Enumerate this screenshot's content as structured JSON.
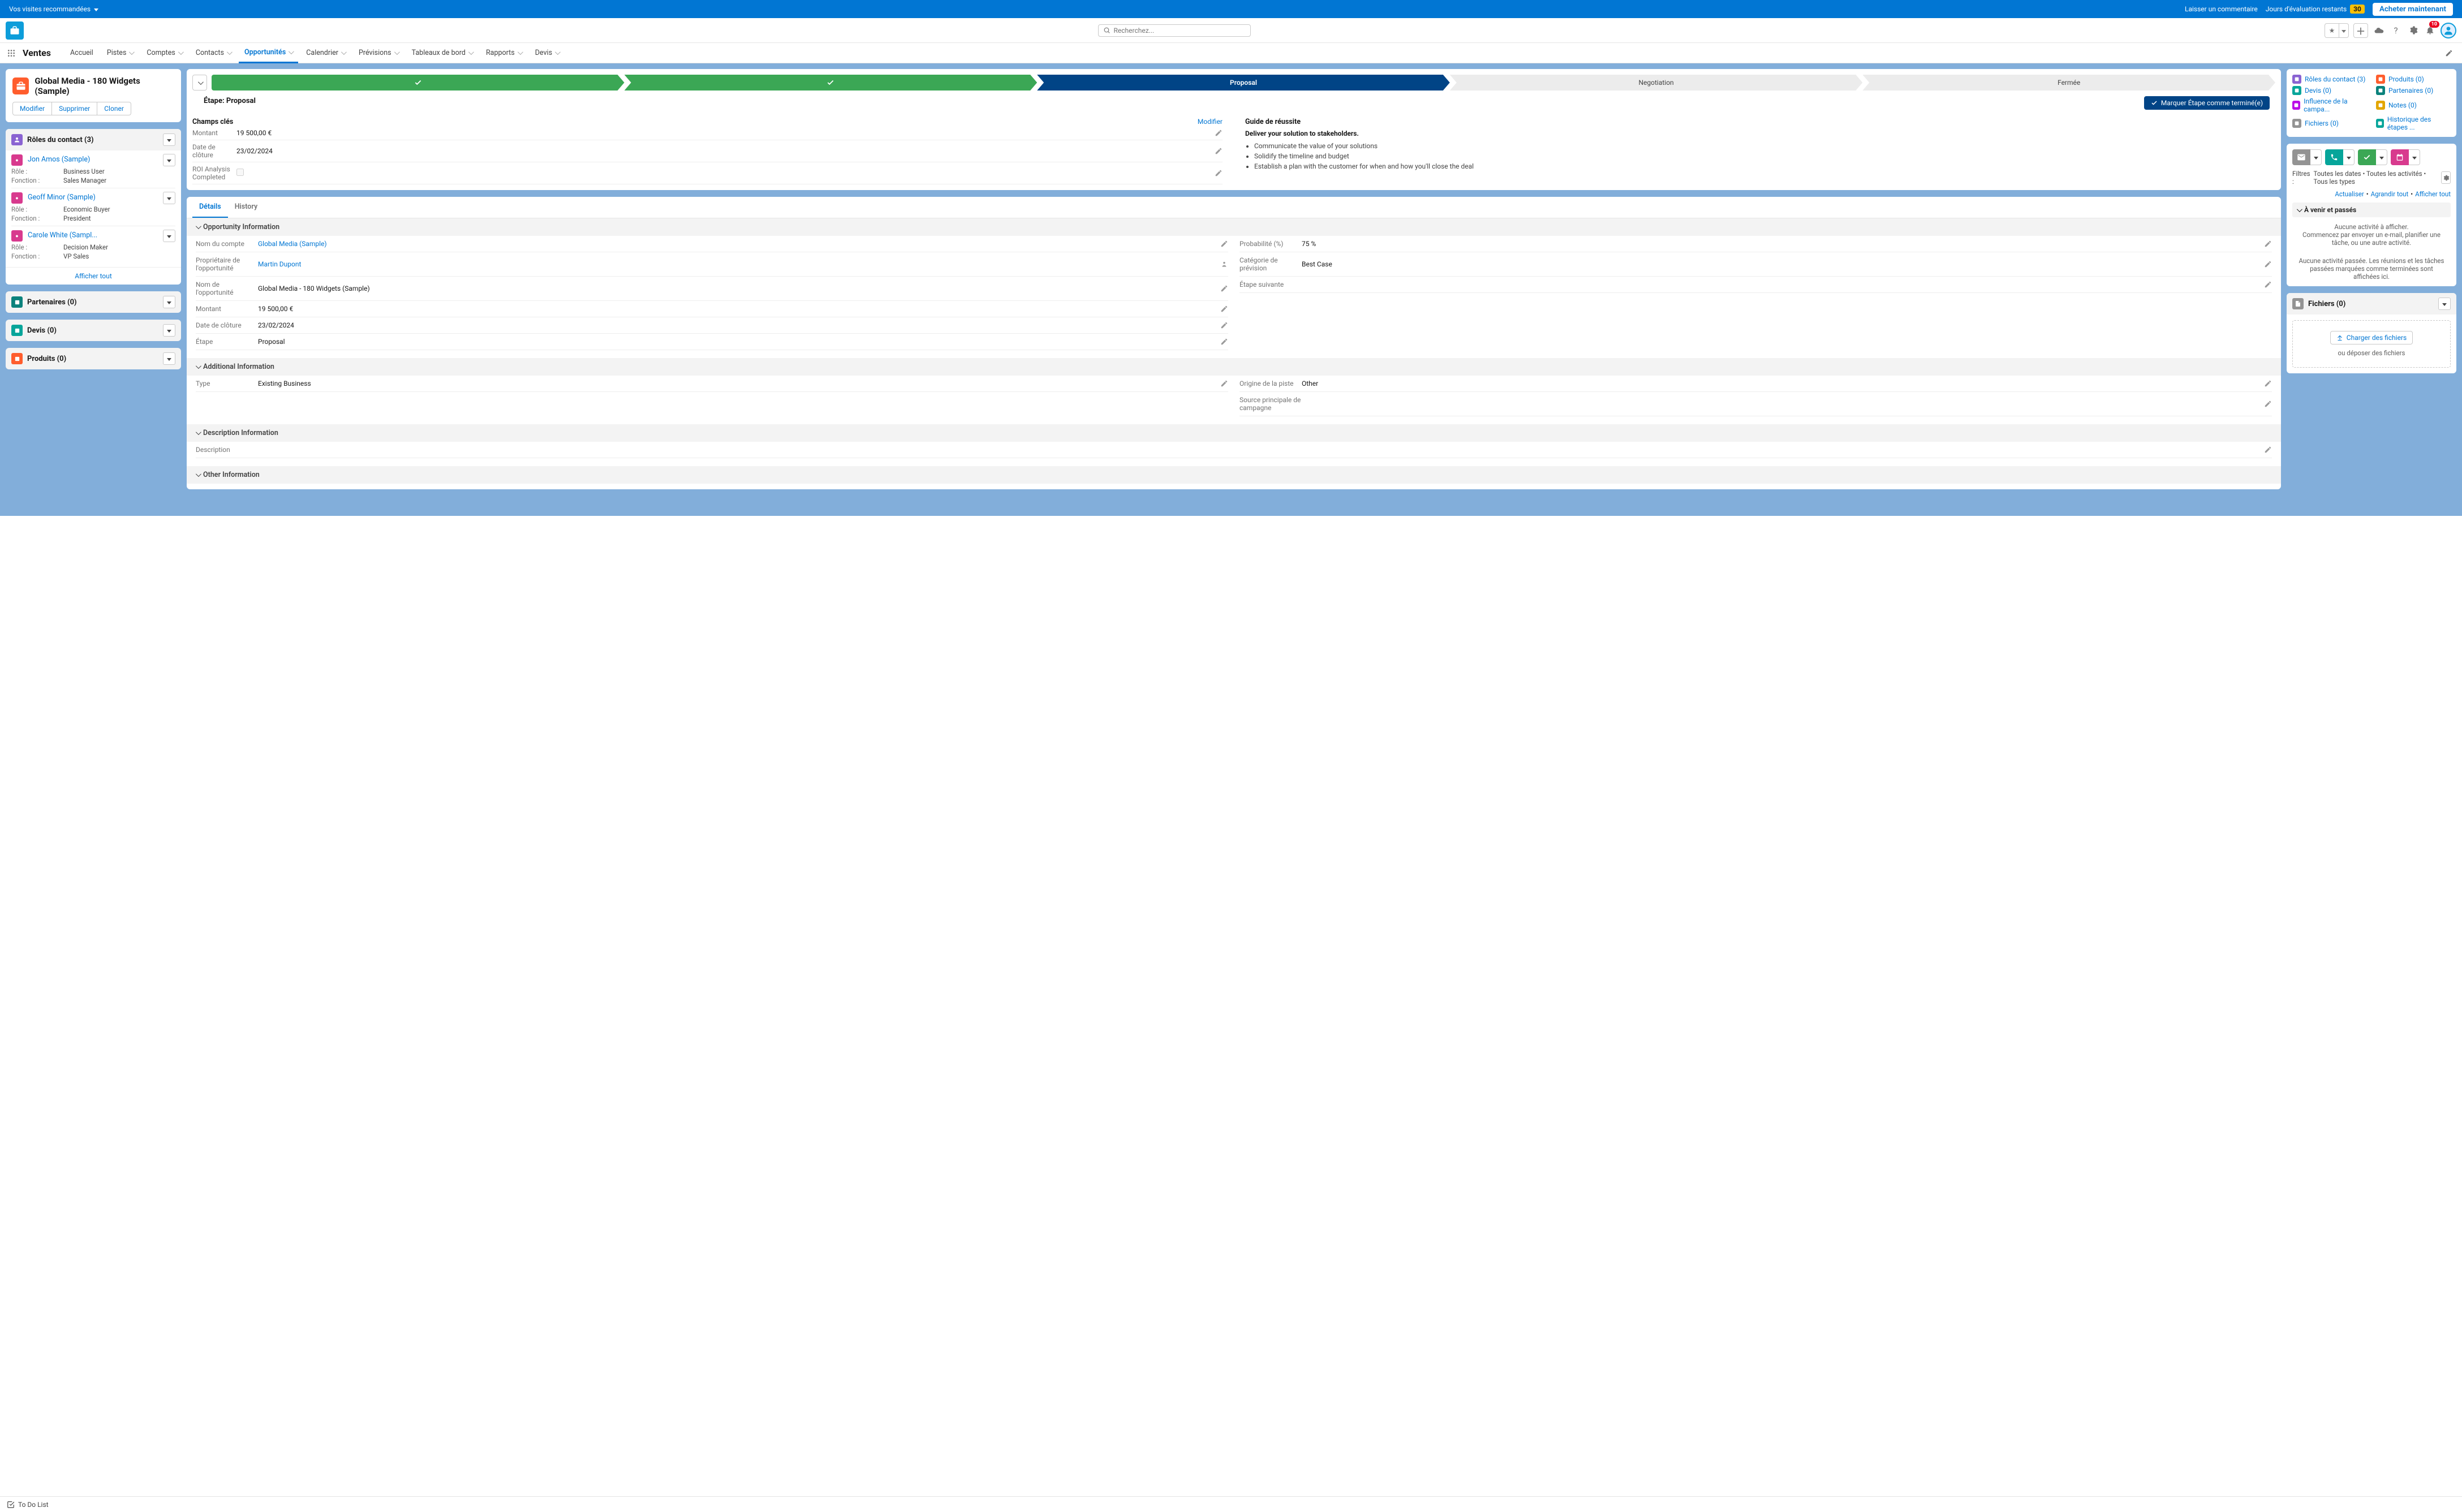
{
  "topBanner": {
    "recommended": "Vos visites recommandées",
    "leaveComment": "Laisser un commentaire",
    "trialDays": "Jours d'évaluation restants",
    "daysBadge": "30",
    "buyNow": "Acheter maintenant"
  },
  "search": {
    "placeholder": "Recherchez..."
  },
  "notifCount": "10",
  "nav": {
    "appName": "Ventes",
    "tabs": [
      "Accueil",
      "Pistes",
      "Comptes",
      "Contacts",
      "Opportunités",
      "Calendrier",
      "Prévisions",
      "Tableaux de bord",
      "Rapports",
      "Devis"
    ],
    "activeIndex": 4
  },
  "record": {
    "title": "Global Media - 180 Widgets (Sample)",
    "actions": [
      "Modifier",
      "Supprimer",
      "Cloner"
    ]
  },
  "contactRoles": {
    "title": "Rôles du contact (3)",
    "items": [
      {
        "name": "Jon Amos (Sample)",
        "role": "Business User",
        "func": "Sales Manager"
      },
      {
        "name": "Geoff Minor (Sample)",
        "role": "Economic Buyer",
        "func": "President"
      },
      {
        "name": "Carole White (Sampl...",
        "role": "Decision Maker",
        "func": "VP Sales"
      }
    ],
    "roleLabel": "Rôle :",
    "funcLabel": "Fonction :",
    "showAll": "Afficher tout"
  },
  "sidePanels": [
    {
      "title": "Partenaires (0)",
      "color": "#0b827c"
    },
    {
      "title": "Devis (0)",
      "color": "#06a59a"
    },
    {
      "title": "Produits (0)",
      "color": "#ff5d2d"
    }
  ],
  "stage": {
    "label": "Étape: Proposal",
    "markComplete": "Marquer Étape comme terminé(e)",
    "steps": [
      "",
      "",
      "Proposal",
      "Negotiation",
      "Fermée"
    ],
    "keyFields": {
      "title": "Champs clés",
      "edit": "Modifier",
      "fields": [
        {
          "label": "Montant",
          "value": "19 500,00 €"
        },
        {
          "label": "Date de clôture",
          "value": "23/02/2024"
        },
        {
          "label": "ROI Analysis Completed",
          "value": ""
        }
      ]
    },
    "guide": {
      "title": "Guide de réussite",
      "headline": "Deliver your solution to stakeholders.",
      "bullets": [
        "Communicate the value of your solutions",
        "Solidify the timeline and budget",
        "Establish a plan with the customer for when and how you'll close the deal"
      ]
    }
  },
  "detailsTabs": [
    "Détails",
    "History"
  ],
  "sections": {
    "oppInfo": {
      "title": "Opportunity Information",
      "left": [
        {
          "label": "Nom du compte",
          "value": "Global Media (Sample)",
          "link": true
        },
        {
          "label": "Propriétaire de l'opportunité",
          "value": "Martin Dupont",
          "link": true,
          "owner": true
        },
        {
          "label": "Nom de l'opportunité",
          "value": "Global Media - 180 Widgets (Sample)"
        },
        {
          "label": "Montant",
          "value": "19 500,00 €"
        },
        {
          "label": "Date de clôture",
          "value": "23/02/2024"
        },
        {
          "label": "Étape",
          "value": "Proposal"
        }
      ],
      "right": [
        {
          "label": "Probabilité (%)",
          "value": "75 %"
        },
        {
          "label": "Catégorie de prévision",
          "value": "Best Case"
        },
        {
          "label": "Étape suivante",
          "value": ""
        }
      ]
    },
    "addl": {
      "title": "Additional Information",
      "left": [
        {
          "label": "Type",
          "value": "Existing Business"
        }
      ],
      "right": [
        {
          "label": "Origine de la piste",
          "value": "Other"
        },
        {
          "label": "Source principale de campagne",
          "value": ""
        }
      ]
    },
    "desc": {
      "title": "Description Information",
      "left": [
        {
          "label": "Description",
          "value": ""
        }
      ]
    },
    "other": {
      "title": "Other Information"
    }
  },
  "quickLinks": {
    "left": [
      {
        "label": "Rôles du contact (3)",
        "color": "#8a63d2"
      },
      {
        "label": "Devis (0)",
        "color": "#06a59a"
      },
      {
        "label": "Influence de la campa...",
        "color": "#ba0de8"
      },
      {
        "label": "Fichiers (0)",
        "color": "#939393"
      }
    ],
    "right": [
      {
        "label": "Produits (0)",
        "color": "#ff5d2d"
      },
      {
        "label": "Partenaires (0)",
        "color": "#0b827c"
      },
      {
        "label": "Notes (0)",
        "color": "#e3a600"
      },
      {
        "label": "Historique des étapes ...",
        "color": "#06a59a"
      }
    ]
  },
  "activity": {
    "filtersPrefix": "Filtres :",
    "filters": "Toutes les dates • Toutes les activités • Tous les types",
    "refresh": "Actualiser",
    "expand": "Agrandir tout",
    "showAll": "Afficher tout",
    "upcomingHeader": "À venir et passés",
    "noActivityLine1": "Aucune activité à afficher.",
    "noActivityLine2": "Commencez par envoyer un e-mail, planifier une tâche, ou une autre activité.",
    "noPast": "Aucune activité passée. Les réunions et les tâches passées marquées comme terminées sont affichées ici."
  },
  "files": {
    "title": "Fichiers (0)",
    "upload": "Charger des fichiers",
    "drop": "ou déposer des fichiers"
  },
  "footer": {
    "todo": "To Do List"
  }
}
